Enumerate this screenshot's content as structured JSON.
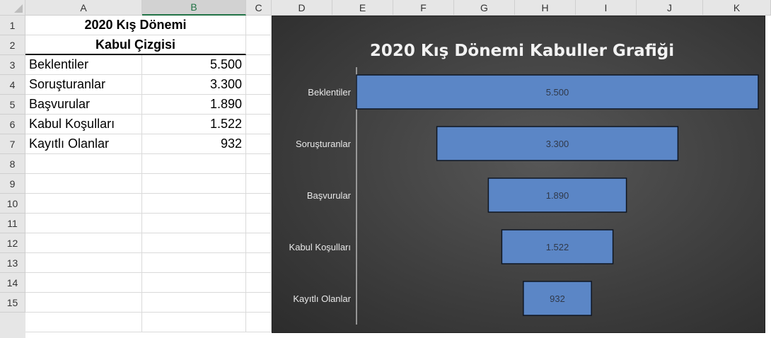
{
  "columns": [
    "A",
    "B",
    "C",
    "D",
    "E",
    "F",
    "G",
    "H",
    "I",
    "J",
    "K"
  ],
  "rows": [
    "1",
    "2",
    "3",
    "4",
    "5",
    "6",
    "7",
    "8",
    "9",
    "10",
    "11",
    "12",
    "13",
    "14",
    "15"
  ],
  "table": {
    "title_line1": "2020 Kış Dönemi",
    "title_line2": "Kabul Çizgisi",
    "items": [
      {
        "label": "Beklentiler",
        "value": "5.500"
      },
      {
        "label": "Soruşturanlar",
        "value": "3.300"
      },
      {
        "label": "Başvurular",
        "value": "1.890"
      },
      {
        "label": "Kabul Koşulları",
        "value": "1.522"
      },
      {
        "label": "Kayıtlı Olanlar",
        "value": "932"
      }
    ]
  },
  "colors": {
    "bar_fill": "#5b86c6",
    "bar_stroke": "#0f1622",
    "selected_header": "#217346"
  },
  "chart_data": {
    "type": "bar",
    "subtype": "funnel",
    "title": "2020 Kış Dönemi Kabuller Grafiği",
    "categories": [
      "Beklentiler",
      "Soruşturanlar",
      "Başvurular",
      "Kabul Koşulları",
      "Kayıtlı Olanlar"
    ],
    "values": [
      5500,
      3300,
      1890,
      1522,
      932
    ],
    "data_labels": [
      "5.500",
      "3.300",
      "1.890",
      "1.522",
      "932"
    ],
    "xlabel": "",
    "ylabel": "",
    "grid": false,
    "legend": "none"
  }
}
